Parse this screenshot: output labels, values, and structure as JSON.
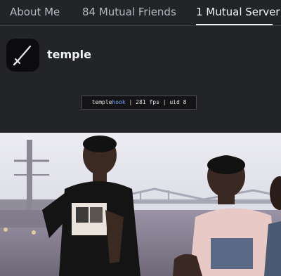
{
  "tabs": [
    {
      "label": "About Me",
      "active": false
    },
    {
      "label": "84 Mutual Friends",
      "active": false
    },
    {
      "label": "1 Mutual Server",
      "active": true
    }
  ],
  "server": {
    "name": "temple",
    "icon": "sword-icon"
  },
  "hud": {
    "prefix": "temple",
    "accent": "hook",
    "suffix": " | 281 fps | uid 8",
    "accent_color": "#7aa2ff"
  },
  "media": {
    "icon": "gif-image"
  }
}
